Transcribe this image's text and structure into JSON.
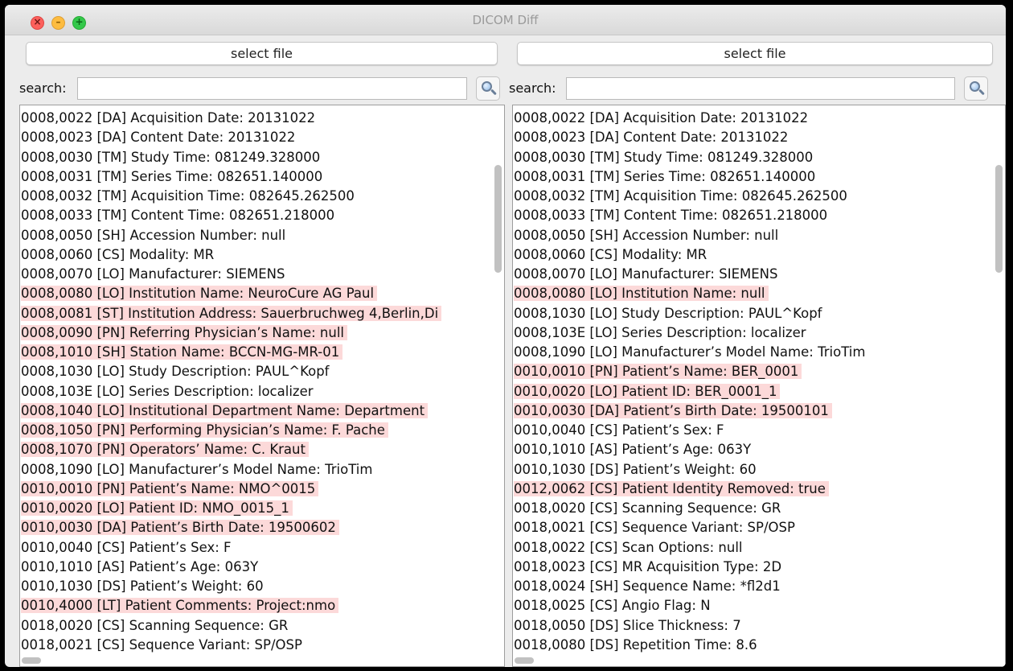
{
  "window": {
    "title": "DICOM Diff",
    "controls": {
      "close_glyph": "×",
      "min_glyph": "–",
      "max_glyph": "+"
    }
  },
  "left_pane": {
    "select_label": "select file",
    "search_label": "search:",
    "search_value": "",
    "search_icon": "magnifier-icon",
    "rows": [
      {
        "text": "0008,0022 [DA] Acquisition Date: 20131022",
        "diff": false
      },
      {
        "text": "0008,0023 [DA] Content Date: 20131022",
        "diff": false
      },
      {
        "text": "0008,0030 [TM] Study Time: 081249.328000",
        "diff": false
      },
      {
        "text": "0008,0031 [TM] Series Time: 082651.140000",
        "diff": false
      },
      {
        "text": "0008,0032 [TM] Acquisition Time: 082645.262500",
        "diff": false
      },
      {
        "text": "0008,0033 [TM] Content Time: 082651.218000",
        "diff": false
      },
      {
        "text": "0008,0050 [SH] Accession Number: null",
        "diff": false
      },
      {
        "text": "0008,0060 [CS] Modality: MR",
        "diff": false
      },
      {
        "text": "0008,0070 [LO] Manufacturer: SIEMENS",
        "diff": false
      },
      {
        "text": "0008,0080 [LO] Institution Name: NeuroCure AG Paul",
        "diff": true
      },
      {
        "text": "0008,0081 [ST] Institution Address: Sauerbruchweg 4,Berlin,Di",
        "diff": true
      },
      {
        "text": "0008,0090 [PN] Referring Physician’s Name: null",
        "diff": true
      },
      {
        "text": "0008,1010 [SH] Station Name: BCCN-MG-MR-01",
        "diff": true
      },
      {
        "text": "0008,1030 [LO] Study Description: PAUL^Kopf",
        "diff": false
      },
      {
        "text": "0008,103E [LO] Series Description: localizer",
        "diff": false
      },
      {
        "text": "0008,1040 [LO] Institutional Department Name: Department",
        "diff": true
      },
      {
        "text": "0008,1050 [PN] Performing Physician’s Name: F. Pache",
        "diff": true
      },
      {
        "text": "0008,1070 [PN] Operators’ Name: C. Kraut",
        "diff": true
      },
      {
        "text": "0008,1090 [LO] Manufacturer’s Model Name: TrioTim",
        "diff": false
      },
      {
        "text": "0010,0010 [PN] Patient’s Name: NMO^0015",
        "diff": true
      },
      {
        "text": "0010,0020 [LO] Patient ID: NMO_0015_1",
        "diff": true
      },
      {
        "text": "0010,0030 [DA] Patient’s Birth Date: 19500602",
        "diff": true
      },
      {
        "text": "0010,0040 [CS] Patient’s Sex: F",
        "diff": false
      },
      {
        "text": "0010,1010 [AS] Patient’s Age: 063Y",
        "diff": false
      },
      {
        "text": "0010,1030 [DS] Patient’s Weight: 60",
        "diff": false
      },
      {
        "text": "0010,4000 [LT] Patient Comments: Project:nmo",
        "diff": true
      },
      {
        "text": "0018,0020 [CS] Scanning Sequence: GR",
        "diff": false
      },
      {
        "text": "0018,0021 [CS] Sequence Variant: SP/OSP",
        "diff": false
      }
    ]
  },
  "right_pane": {
    "select_label": "select file",
    "search_label": "search:",
    "search_value": "",
    "search_icon": "magnifier-icon",
    "rows": [
      {
        "text": "0008,0022 [DA] Acquisition Date: 20131022",
        "diff": false
      },
      {
        "text": "0008,0023 [DA] Content Date: 20131022",
        "diff": false
      },
      {
        "text": "0008,0030 [TM] Study Time: 081249.328000",
        "diff": false
      },
      {
        "text": "0008,0031 [TM] Series Time: 082651.140000",
        "diff": false
      },
      {
        "text": "0008,0032 [TM] Acquisition Time: 082645.262500",
        "diff": false
      },
      {
        "text": "0008,0033 [TM] Content Time: 082651.218000",
        "diff": false
      },
      {
        "text": "0008,0050 [SH] Accession Number: null",
        "diff": false
      },
      {
        "text": "0008,0060 [CS] Modality: MR",
        "diff": false
      },
      {
        "text": "0008,0070 [LO] Manufacturer: SIEMENS",
        "diff": false
      },
      {
        "text": "0008,0080 [LO] Institution Name: null",
        "diff": true
      },
      {
        "text": "0008,1030 [LO] Study Description: PAUL^Kopf",
        "diff": false
      },
      {
        "text": "0008,103E [LO] Series Description: localizer",
        "diff": false
      },
      {
        "text": "0008,1090 [LO] Manufacturer’s Model Name: TrioTim",
        "diff": false
      },
      {
        "text": "0010,0010 [PN] Patient’s Name: BER_0001",
        "diff": true
      },
      {
        "text": "0010,0020 [LO] Patient ID: BER_0001_1",
        "diff": true
      },
      {
        "text": "0010,0030 [DA] Patient’s Birth Date: 19500101",
        "diff": true
      },
      {
        "text": "0010,0040 [CS] Patient’s Sex: F",
        "diff": false
      },
      {
        "text": "0010,1010 [AS] Patient’s Age: 063Y",
        "diff": false
      },
      {
        "text": "0010,1030 [DS] Patient’s Weight: 60",
        "diff": false
      },
      {
        "text": "0012,0062 [CS] Patient Identity Removed: true",
        "diff": true
      },
      {
        "text": "0018,0020 [CS] Scanning Sequence: GR",
        "diff": false
      },
      {
        "text": "0018,0021 [CS] Sequence Variant: SP/OSP",
        "diff": false
      },
      {
        "text": "0018,0022 [CS] Scan Options: null",
        "diff": false
      },
      {
        "text": "0018,0023 [CS] MR Acquisition Type: 2D",
        "diff": false
      },
      {
        "text": "0018,0024 [SH] Sequence Name: *fl2d1",
        "diff": false
      },
      {
        "text": "0018,0025 [CS] Angio Flag: N",
        "diff": false
      },
      {
        "text": "0018,0050 [DS] Slice Thickness: 7",
        "diff": false
      },
      {
        "text": "0018,0080 [DS] Repetition Time: 8.6",
        "diff": false
      }
    ]
  },
  "colors": {
    "diff_highlight": "#fcd9d9",
    "window_bg": "#ececec"
  }
}
